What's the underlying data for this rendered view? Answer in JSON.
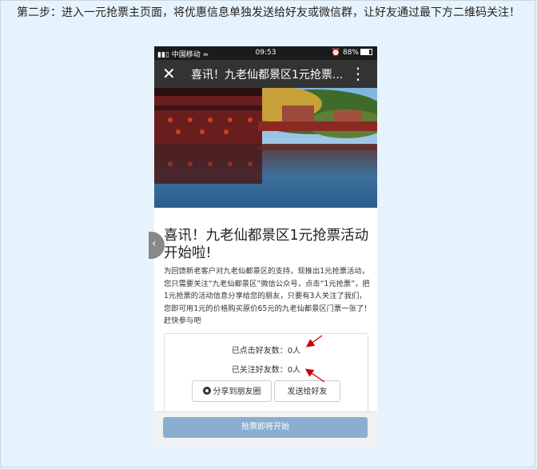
{
  "instruction": "第二步：进入一元抢票主页面，将优惠信息单独发送给好友或微信群，让好友通过最下方二维码关注！",
  "status_bar": {
    "carrier": "中国移动",
    "time": "09:53",
    "battery": "88%"
  },
  "nav": {
    "title": "喜讯！九老仙都景区1元抢票...",
    "close_icon": "close-icon",
    "more_icon": "more-icon"
  },
  "article": {
    "title": "喜讯！九老仙都景区1元抢票活动开始啦!",
    "body": "为回馈新老客户对九老仙都景区的支持，现推出1元抢票活动，您只需要关注“九老仙都景区”微信公众号，点击“1元抢票”，把1元抢票的活动信息分享给您的朋友，只要有3人关注了我们，您即可用1元的价格购买原价65元的九老仙都景区门票一张了！赶快参与吧"
  },
  "stats": {
    "clicked_label": "已点击好友数：",
    "clicked_value": "0人",
    "followed_label": "已关注好友数：",
    "followed_value": "0人"
  },
  "buttons": {
    "share_moments": "分享到朋友圈",
    "send_friend": "发送给好友"
  },
  "bottom": {
    "start_label": "抢票即将开始"
  },
  "colors": {
    "start_button": "#8aaed1",
    "annotation_arrow": "#cc0000"
  }
}
